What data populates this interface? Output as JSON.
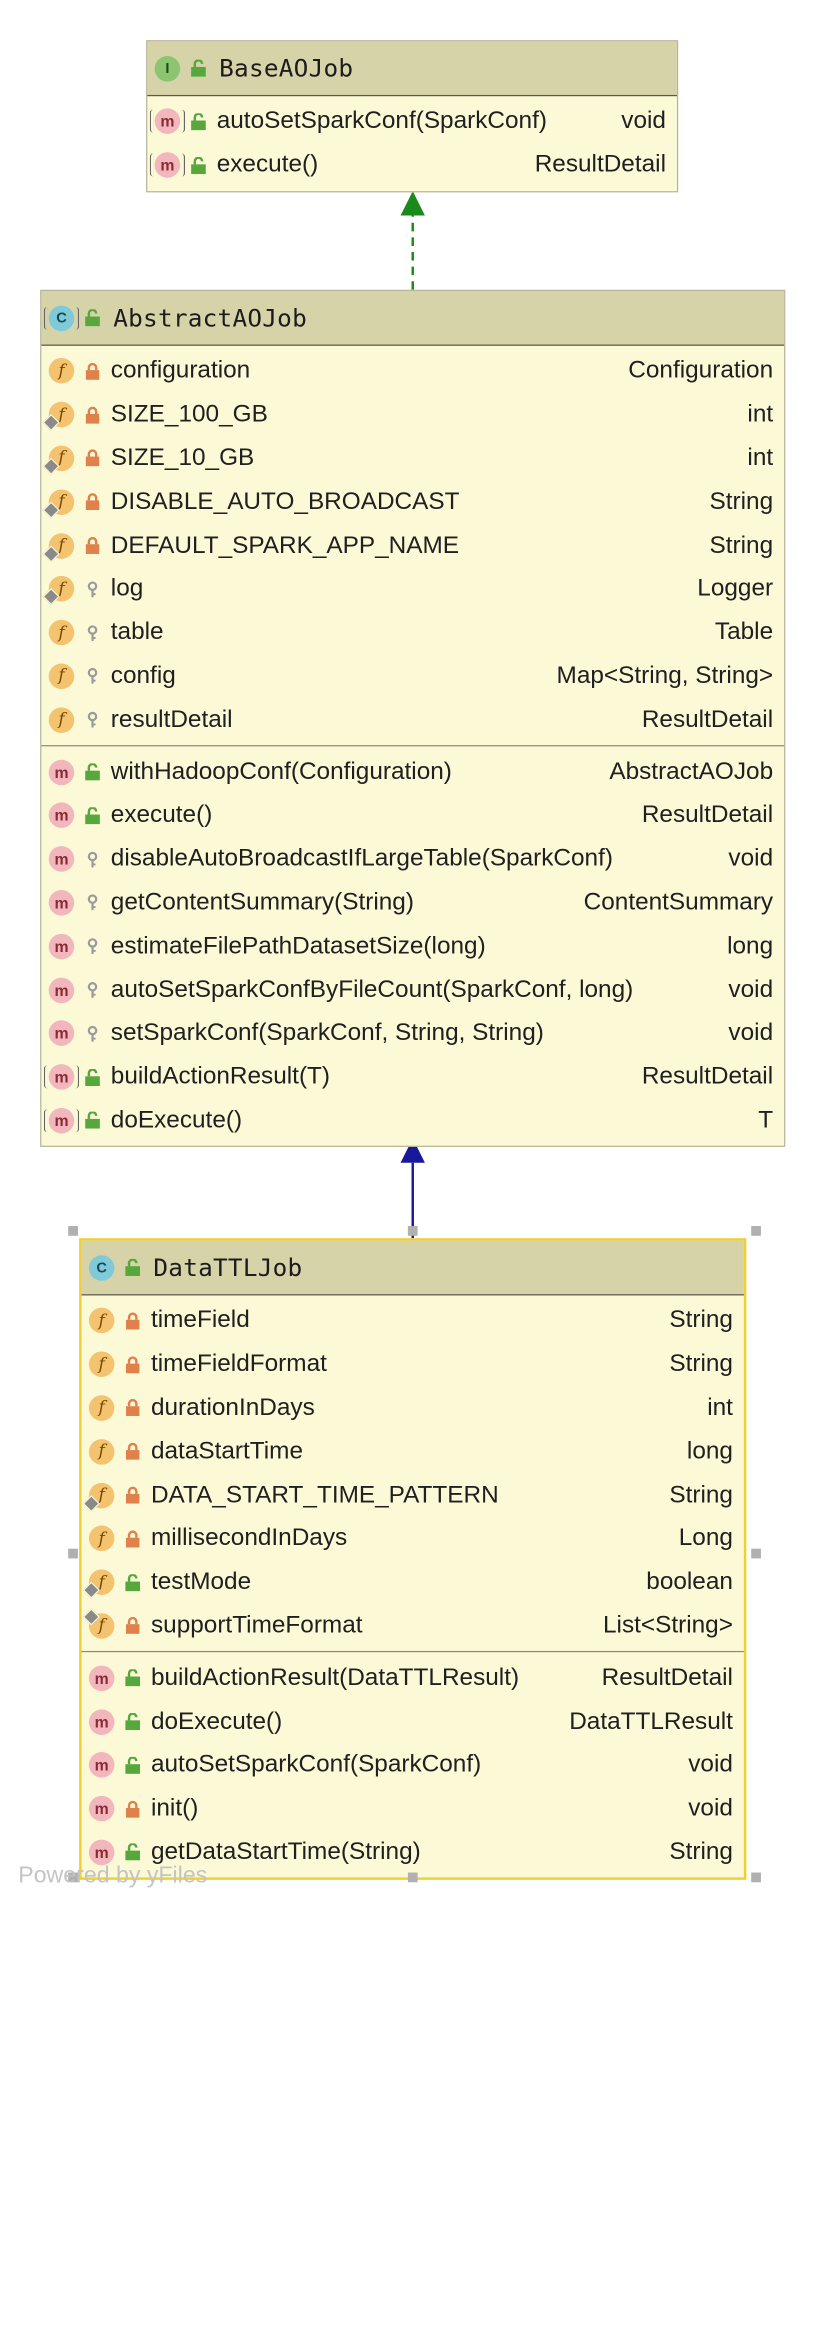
{
  "diagram": {
    "classes": [
      {
        "id": "base",
        "kind": "interface",
        "kind_letter": "I",
        "name": "BaseAOJob",
        "fields": [],
        "methods": [
          {
            "kind": "method",
            "abstract": true,
            "visibility": "public",
            "name": "autoSetSparkConf(SparkConf)",
            "type": "void"
          },
          {
            "kind": "method",
            "abstract": true,
            "visibility": "public",
            "name": "execute()",
            "type": "ResultDetail"
          }
        ]
      },
      {
        "id": "abstract",
        "kind": "class",
        "kind_letter": "C",
        "abstract": true,
        "name": "AbstractAOJob",
        "fields": [
          {
            "kind": "field",
            "visibility": "private",
            "name": "configuration",
            "type": "Configuration"
          },
          {
            "kind": "field",
            "static": true,
            "visibility": "private",
            "name": "SIZE_100_GB",
            "type": "int"
          },
          {
            "kind": "field",
            "static": true,
            "visibility": "private",
            "name": "SIZE_10_GB",
            "type": "int"
          },
          {
            "kind": "field",
            "static": true,
            "visibility": "private",
            "name": "DISABLE_AUTO_BROADCAST",
            "type": "String"
          },
          {
            "kind": "field",
            "static": true,
            "visibility": "private",
            "name": "DEFAULT_SPARK_APP_NAME",
            "type": "String"
          },
          {
            "kind": "field",
            "static": true,
            "visibility": "protected",
            "name": "log",
            "type": "Logger"
          },
          {
            "kind": "field",
            "visibility": "protected",
            "name": "table",
            "type": "Table"
          },
          {
            "kind": "field",
            "visibility": "protected",
            "name": "config",
            "type": "Map<String, String>"
          },
          {
            "kind": "field",
            "visibility": "protected",
            "name": "resultDetail",
            "type": "ResultDetail"
          }
        ],
        "methods": [
          {
            "kind": "method",
            "visibility": "public",
            "name": "withHadoopConf(Configuration)",
            "type": "AbstractAOJob"
          },
          {
            "kind": "method",
            "visibility": "public",
            "name": "execute()",
            "type": "ResultDetail"
          },
          {
            "kind": "method",
            "visibility": "protected",
            "name": "disableAutoBroadcastIfLargeTable(SparkConf)",
            "type": "void"
          },
          {
            "kind": "method",
            "visibility": "protected",
            "name": "getContentSummary(String)",
            "type": "ContentSummary"
          },
          {
            "kind": "method",
            "visibility": "protected",
            "name": "estimateFilePathDatasetSize(long)",
            "type": "long"
          },
          {
            "kind": "method",
            "visibility": "protected",
            "name": "autoSetSparkConfByFileCount(SparkConf, long)",
            "type": "void"
          },
          {
            "kind": "method",
            "visibility": "protected",
            "name": "setSparkConf(SparkConf, String, String)",
            "type": "void"
          },
          {
            "kind": "method",
            "abstract": true,
            "visibility": "public",
            "name": "buildActionResult(T)",
            "type": "ResultDetail"
          },
          {
            "kind": "method",
            "abstract": true,
            "visibility": "public",
            "name": "doExecute()",
            "type": "T"
          }
        ]
      },
      {
        "id": "datattl",
        "kind": "class",
        "kind_letter": "C",
        "name": "DataTTLJob",
        "selected": true,
        "fields": [
          {
            "kind": "field",
            "visibility": "private",
            "name": "timeField",
            "type": "String"
          },
          {
            "kind": "field",
            "visibility": "private",
            "name": "timeFieldFormat",
            "type": "String"
          },
          {
            "kind": "field",
            "visibility": "private",
            "name": "durationInDays",
            "type": "int"
          },
          {
            "kind": "field",
            "visibility": "private",
            "name": "dataStartTime",
            "type": "long"
          },
          {
            "kind": "field",
            "static": true,
            "visibility": "private",
            "name": "DATA_START_TIME_PATTERN",
            "type": "String"
          },
          {
            "kind": "field",
            "visibility": "private",
            "name": "millisecondInDays",
            "type": "Long"
          },
          {
            "kind": "field",
            "static": true,
            "visibility": "public",
            "name": "testMode",
            "type": "boolean"
          },
          {
            "kind": "field",
            "static": true,
            "static_top": true,
            "visibility": "private",
            "name": "supportTimeFormat",
            "type": "List<String>"
          }
        ],
        "methods": [
          {
            "kind": "method",
            "visibility": "public",
            "name": "buildActionResult(DataTTLResult)",
            "type": "ResultDetail"
          },
          {
            "kind": "method",
            "visibility": "public",
            "name": "doExecute()",
            "type": "DataTTLResult"
          },
          {
            "kind": "method",
            "visibility": "public",
            "name": "autoSetSparkConf(SparkConf)",
            "type": "void"
          },
          {
            "kind": "method",
            "visibility": "private",
            "name": "init()",
            "type": "void"
          },
          {
            "kind": "method",
            "visibility": "public",
            "name": "getDataStartTime(String)",
            "type": "String"
          }
        ]
      }
    ],
    "relations": [
      {
        "from": "abstract",
        "to": "base",
        "type": "realization",
        "color": "#1a8a1a"
      },
      {
        "from": "datattl",
        "to": "abstract",
        "type": "generalization",
        "color": "#17189a"
      }
    ],
    "colors": {
      "box_fill": "#fcf9d7",
      "header_fill": "#d7d3a8",
      "selection": "#f0cf35",
      "realization_arrow": "#1a8a1a",
      "inheritance_arrow": "#17189a"
    }
  },
  "footer": {
    "text": "Powered by yFiles"
  }
}
